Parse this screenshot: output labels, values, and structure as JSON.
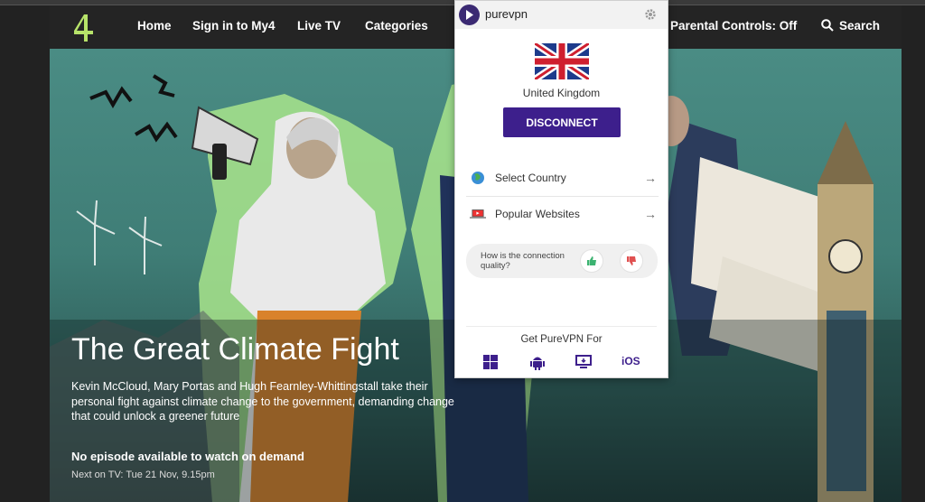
{
  "nav": {
    "logo_icon": "channel4-logo-icon",
    "items": [
      "Home",
      "Sign in to My4",
      "Live TV",
      "Categories"
    ],
    "parental_controls": "Parental Controls: Off",
    "search_label": "Search"
  },
  "hero": {
    "title": "The Great Climate Fight",
    "description": "Kevin McCloud, Mary Portas and Hugh Fearnley-Whittingstall take their personal fight against climate change to the government, demanding change that could unlock a greener future",
    "availability": "No episode available to watch on demand",
    "next_on_tv": "Next on TV: Tue 21 Nov, 9.15pm"
  },
  "vpn": {
    "brand": "purevpn",
    "country": "United Kingdom",
    "disconnect_label": "DISCONNECT",
    "menu": [
      {
        "label": "Select Country",
        "icon": "globe-icon"
      },
      {
        "label": "Popular Websites",
        "icon": "laptop-icon"
      }
    ],
    "feedback_question": "How is the connection quality?",
    "get_for_label": "Get PureVPN For",
    "platforms": [
      "windows-icon",
      "android-icon",
      "desktop-icon",
      "iOS"
    ],
    "ios_label": "iOS",
    "colors": {
      "accent": "#3d1f8c",
      "thumb_up": "#3cb371",
      "thumb_down": "#e05050"
    }
  }
}
